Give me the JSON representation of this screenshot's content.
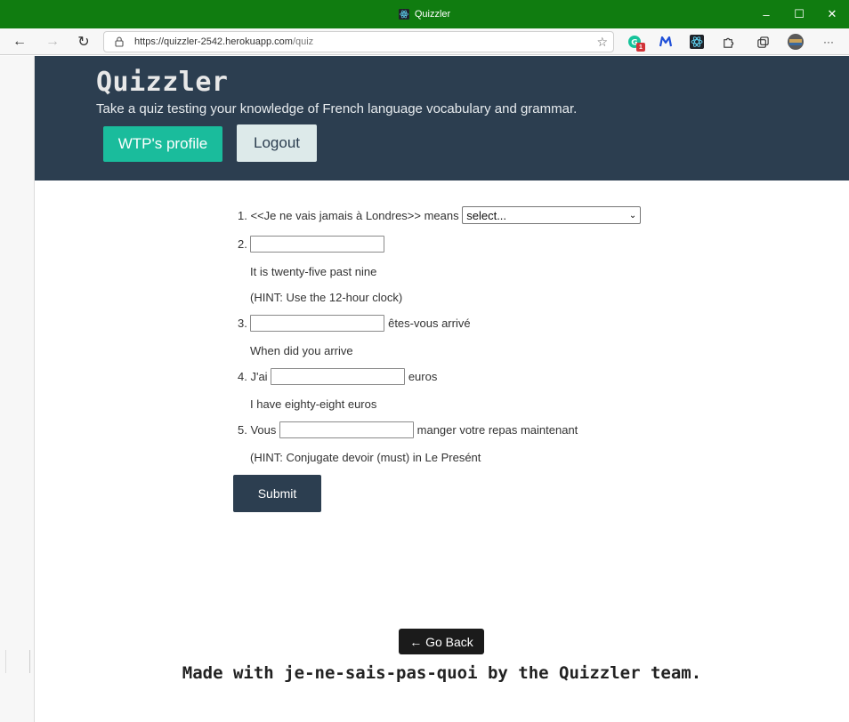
{
  "window": {
    "title": "Quizzler",
    "minimize": "–",
    "maximize": "☐",
    "close": "✕"
  },
  "browser": {
    "back": "←",
    "forward": "→",
    "refresh": "↻",
    "url_host": "https://quizzler-2542.herokuapp.com",
    "url_path": "/quiz",
    "favorites_icon": "☆",
    "extension_badge": "1",
    "menu": "···"
  },
  "header": {
    "title": "Quizzler",
    "subtitle": "Take a quiz testing your knowledge of French language vocabulary and grammar.",
    "profile_button": "WTP's profile",
    "logout_button": "Logout"
  },
  "quiz": {
    "q1": {
      "number": "1.",
      "prompt": "<<Je ne vais jamais à Londres>> means",
      "select_value": "select..."
    },
    "q2": {
      "number": "2.",
      "translation": "It is twenty-five past nine",
      "hint": "(HINT: Use the 12-hour clock)"
    },
    "q3": {
      "number": "3.",
      "after": "êtes-vous arrivé",
      "translation": "When did you arrive"
    },
    "q4": {
      "number": "4.",
      "before": "J'ai",
      "after": "euros",
      "translation": "I have eighty-eight euros"
    },
    "q5": {
      "number": "5.",
      "before": "Vous",
      "after": "manger votre repas maintenant",
      "hint": "(HINT: Conjugate devoir (must) in Le Presént"
    },
    "submit": "Submit"
  },
  "go_back": "← Go Back",
  "footer": "Made with je-ne-sais-pas-quoi by the Quizzler team.",
  "colors": {
    "titlebar": "#107c10",
    "header_bg": "#2c3e50",
    "accent": "#1abc9c"
  }
}
